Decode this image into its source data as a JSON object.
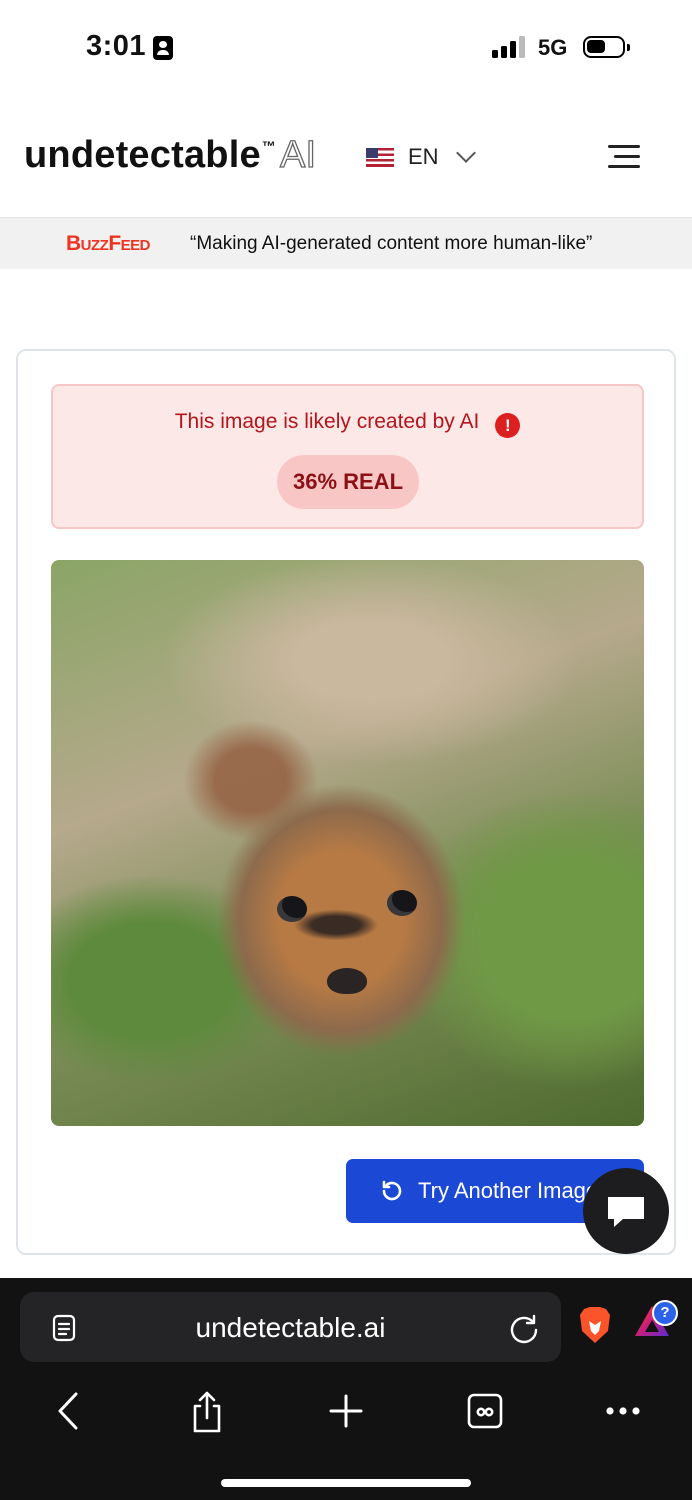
{
  "status_bar": {
    "time": "3:01",
    "network": "5G"
  },
  "header": {
    "logo_text": "undetectable",
    "logo_tm": "™",
    "logo_ai": "AI",
    "language": "EN"
  },
  "banner": {
    "brand": "BuzzFeed",
    "quote": "“Making AI-generated content more human-like”"
  },
  "result": {
    "message": "This image is likely created by AI",
    "alert_icon": "!",
    "score_label": "36% REAL",
    "score_real_percent": 36,
    "button_label": "Try Another Image"
  },
  "browser": {
    "url": "undetectable.ai",
    "rewards_badge": "?"
  },
  "colors": {
    "alert_bg": "#fde8e8",
    "alert_text": "#b3151b",
    "score_bg": "#f9c6c6",
    "primary_button": "#1b49d6",
    "browser_bg": "#121213"
  },
  "icons": {
    "flag": "us-flag-icon",
    "menu": "hamburger-menu-icon",
    "alert": "exclamation-circle-icon",
    "retry": "reload-icon",
    "chat": "chat-bubble-icon",
    "reader": "reader-mode-icon",
    "refresh": "refresh-icon",
    "brave": "brave-shield-icon",
    "rewards": "brave-rewards-icon",
    "back": "back-arrow-icon",
    "share": "share-icon",
    "new_tab": "plus-icon",
    "tabs": "tabs-icon",
    "more": "more-dots-icon"
  }
}
